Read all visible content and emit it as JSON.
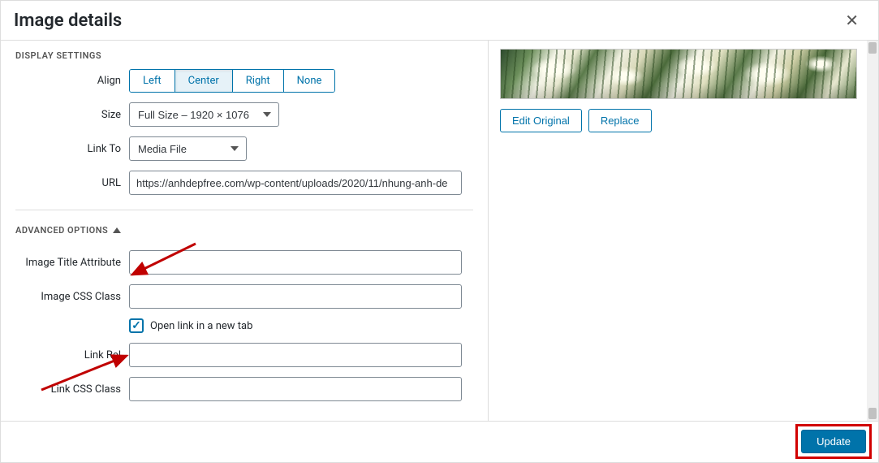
{
  "header": {
    "title": "Image details"
  },
  "display_settings": {
    "heading": "DISPLAY SETTINGS",
    "align": {
      "label": "Align",
      "options": {
        "left": "Left",
        "center": "Center",
        "right": "Right",
        "none": "None"
      },
      "selected": "center"
    },
    "size": {
      "label": "Size",
      "value": "Full Size – 1920 × 1076"
    },
    "link_to": {
      "label": "Link To",
      "value": "Media File"
    },
    "url": {
      "label": "URL",
      "value": "https://anhdepfree.com/wp-content/uploads/2020/11/nhung-anh-de"
    }
  },
  "advanced": {
    "heading": "ADVANCED OPTIONS",
    "title_attr": {
      "label": "Image Title Attribute",
      "value": ""
    },
    "css_class": {
      "label": "Image CSS Class",
      "value": ""
    },
    "open_new_tab": {
      "label": "Open link in a new tab",
      "checked": true
    },
    "link_rel": {
      "label": "Link Rel",
      "value": ""
    },
    "link_css": {
      "label": "Link CSS Class",
      "value": ""
    }
  },
  "right": {
    "edit_original": "Edit Original",
    "replace": "Replace"
  },
  "footer": {
    "update": "Update"
  }
}
